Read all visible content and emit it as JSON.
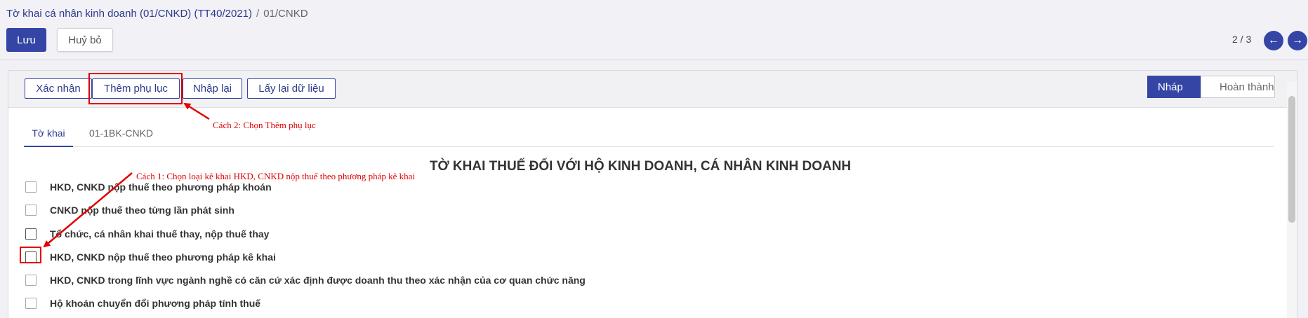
{
  "breadcrumb": {
    "link": "Tờ khai cá nhân kinh doanh (01/CNKD) (TT40/2021)",
    "separator": "/",
    "current": "01/CNKD"
  },
  "toolbar": {
    "save_label": "Lưu",
    "discard_label": "Huỷ bỏ"
  },
  "pager": {
    "text": "2 / 3",
    "prev_icon": "arrow-left-icon",
    "next_icon": "arrow-right-icon"
  },
  "header_buttons": {
    "confirm": "Xác nhận",
    "add_addendum": "Thêm phụ lục",
    "reset": "Nhập lại",
    "reload_data": "Lấy lại dữ liệu"
  },
  "status": {
    "draft": "Nháp",
    "done": "Hoàn thành",
    "current": "Nháp"
  },
  "tabs": [
    {
      "label": "Tờ khai",
      "active": true
    },
    {
      "label": "01-1BK-CNKD",
      "active": false
    }
  ],
  "form_title": "TỜ KHAI THUẾ ĐỐI VỚI HỘ KINH DOANH, CÁ NHÂN KINH DOANH",
  "options": [
    {
      "label": "HKD, CNKD nộp thuế theo phương pháp khoán",
      "checked": false
    },
    {
      "label": "CNKD nộp thuế theo từng lần phát sinh",
      "checked": false
    },
    {
      "label": "Tổ chức, cá nhân khai thuế thay, nộp thuế thay",
      "checked": false
    },
    {
      "label": "HKD, CNKD nộp thuế theo phương pháp kê khai",
      "checked": false
    },
    {
      "label": "HKD, CNKD trong lĩnh vực ngành nghề có căn cứ xác định được doanh thu theo xác nhận của cơ quan chức năng",
      "checked": false
    },
    {
      "label": "Hộ khoán chuyển đổi phương pháp tính thuế",
      "checked": false
    }
  ],
  "annotations": {
    "method_1": "Cách 1: Chọn loại kê khai HKD, CNKD nộp thuế theo phương pháp kê khai",
    "method_2": "Cách 2: Chọn Thêm phụ lục",
    "color": "#e10000"
  },
  "colors": {
    "primary": "#3545a6",
    "link": "#2d3a8c"
  }
}
